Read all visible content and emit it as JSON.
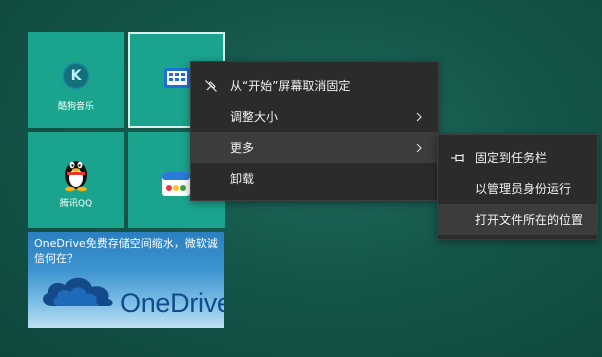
{
  "tiles": {
    "kugou": {
      "label": "酷狗音乐",
      "icon": "kugou-k-icon",
      "letter": "K"
    },
    "selected_app": {
      "icon": "app-tile-icon"
    },
    "qq": {
      "label": "腾讯QQ",
      "icon": "qq-penguin-icon"
    },
    "store": {
      "icon": "store-app-icon"
    },
    "onedrive": {
      "promo_text": "OneDrive免费存储空间缩水，微软诚信何在？",
      "logo_text": "OneDrive",
      "icon": "onedrive-cloud-icon"
    }
  },
  "context_menu": {
    "items": [
      {
        "label": "从“开始”屏幕取消固定",
        "icon": "unpin-icon"
      },
      {
        "label": "调整大小",
        "has_submenu": true
      },
      {
        "label": "更多",
        "has_submenu": true,
        "highlighted": true
      },
      {
        "label": "卸载"
      }
    ]
  },
  "submenu": {
    "items": [
      {
        "label": "固定到任务栏",
        "icon": "pin-taskbar-icon"
      },
      {
        "label": "以管理员身份运行"
      },
      {
        "label": "打开文件所在的位置",
        "highlighted": true
      }
    ]
  },
  "colors": {
    "desktop_bg": "#15564a",
    "tile_accent": "#1aa48d",
    "menu_bg": "#2b2b2b",
    "menu_hover": "#3c3c3c",
    "menu_text": "#f2f2f2"
  }
}
